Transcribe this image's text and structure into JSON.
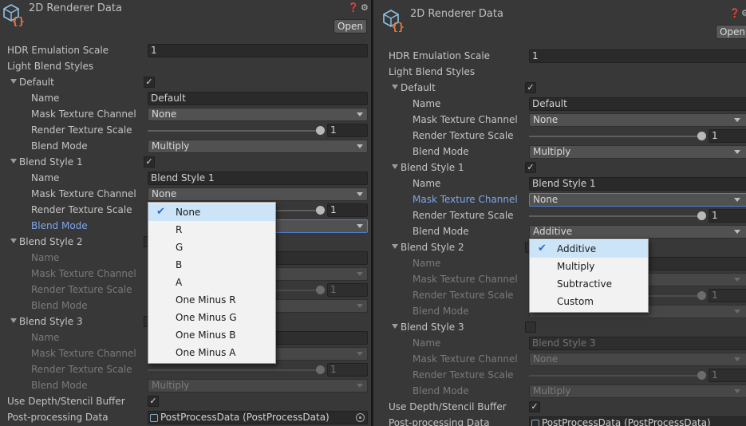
{
  "title": "2D Renderer Data",
  "open_label": "Open",
  "help_icon": "help-icon",
  "settings_icon": "gear-icon",
  "fields": {
    "hdr_label": "HDR Emulation Scale",
    "hdr_value": "1",
    "light_blend_styles_label": "Light Blend Styles",
    "name_label": "Name",
    "mask_label": "Mask Texture Channel",
    "rts_label": "Render Texture Scale",
    "blend_mode_label": "Blend Mode",
    "use_depth_label": "Use Depth/Stencil Buffer",
    "post_label": "Post-processing Data",
    "post_value": "PostProcessData (PostProcessData)"
  },
  "left": {
    "styles": [
      {
        "header": "Default",
        "name": "Default",
        "mask": "None",
        "rts": "1",
        "blend": "Multiply"
      },
      {
        "header": "Blend Style 1",
        "name": "Blend Style 1",
        "mask": "None",
        "rts": "1",
        "blend": ""
      },
      {
        "header": "Blend Style 2",
        "name": "",
        "mask": "",
        "rts": "1",
        "blend": ""
      },
      {
        "header": "Blend Style 3",
        "name": "",
        "mask": "",
        "rts": "1",
        "blend": "Multiply"
      }
    ],
    "popup": {
      "options": [
        "None",
        "R",
        "G",
        "B",
        "A",
        "One Minus R",
        "One Minus G",
        "One Minus B",
        "One Minus A"
      ],
      "selected": "None"
    }
  },
  "right": {
    "styles": [
      {
        "header": "Default",
        "name": "Default",
        "mask": "None",
        "rts": "1",
        "blend": "Multiply"
      },
      {
        "header": "Blend Style 1",
        "name": "Blend Style 1",
        "mask": "None",
        "rts": "1",
        "blend": "Additive"
      },
      {
        "header": "Blend Style 2",
        "name": "",
        "mask": "",
        "rts": "1",
        "blend": ""
      },
      {
        "header": "Blend Style 3",
        "name": "Blend Style 3",
        "mask": "None",
        "rts": "1",
        "blend": "Multiply"
      }
    ],
    "popup": {
      "options": [
        "Additive",
        "Multiply",
        "Subtractive",
        "Custom"
      ],
      "selected": "Additive"
    }
  },
  "colors": {
    "accent": "#4d7ecc",
    "highlight_label": "#7ba7ea",
    "panel_bg": "#383838"
  }
}
